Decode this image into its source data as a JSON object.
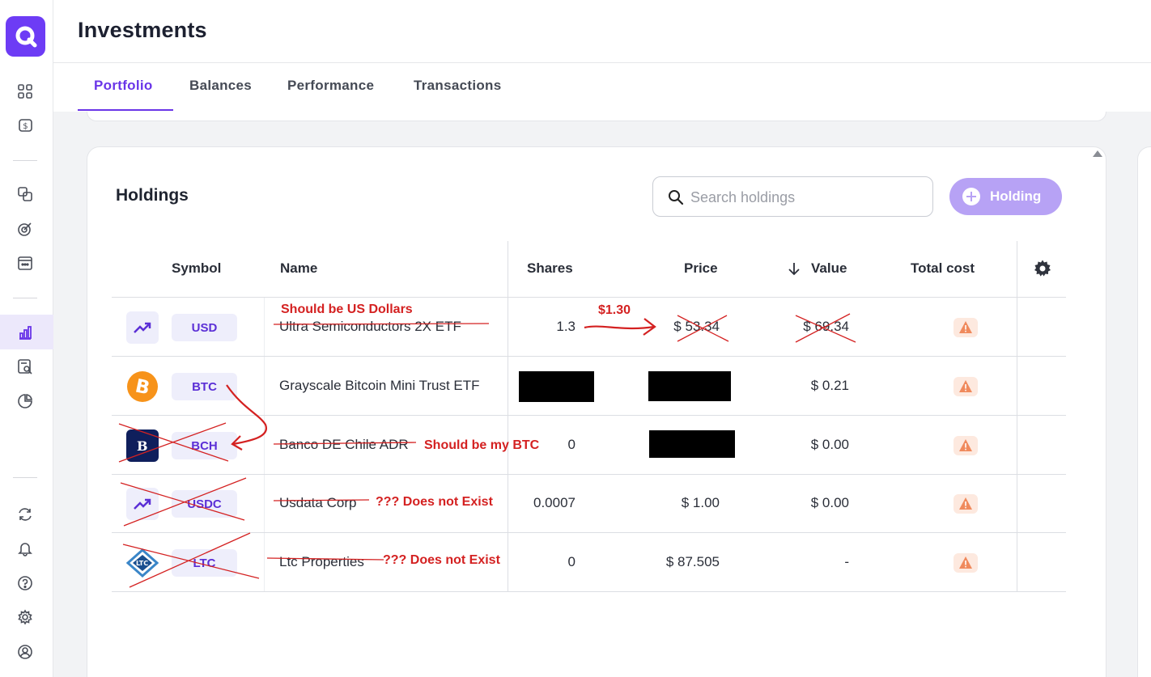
{
  "header": {
    "title": "Investments"
  },
  "tabs": [
    {
      "label": "Portfolio",
      "active": true
    },
    {
      "label": "Balances"
    },
    {
      "label": "Performance"
    },
    {
      "label": "Transactions"
    }
  ],
  "holdings": {
    "title": "Holdings",
    "search_placeholder": "Search holdings",
    "add_button": "Holding"
  },
  "table": {
    "columns": [
      "Symbol",
      "Name",
      "Shares",
      "Price",
      "Value",
      "Total cost"
    ],
    "sort_column": "Value",
    "rows": [
      {
        "symbol": "USD",
        "name": "Ultra Semiconductors 2X ETF",
        "shares": "1.3",
        "price": "$ 53.34",
        "value": "$ 69.34",
        "icon": "trend-up-icon"
      },
      {
        "symbol": "BTC",
        "name": "Grayscale Bitcoin Mini Trust ETF",
        "shares": "",
        "price": "",
        "value": "$ 0.21",
        "icon": "bitcoin-icon"
      },
      {
        "symbol": "BCH",
        "name": "Banco DE Chile ADR",
        "shares": "0",
        "price": "",
        "value": "$ 0.00",
        "icon": "banco-chile-logo-icon"
      },
      {
        "symbol": "USDC",
        "name": "Usdata Corp",
        "shares": "0.0007",
        "price": "$ 1.00",
        "value": "$ 0.00",
        "icon": "trend-up-icon"
      },
      {
        "symbol": "LTC",
        "name": "Ltc Properties",
        "shares": "0",
        "price": "$ 87.505",
        "value": "-",
        "icon": "ltc-logo-icon"
      }
    ]
  },
  "annotations": {
    "usd_name": "Should be US Dollars",
    "usd_price": "$1.30",
    "bch_note": "Should be my BTC",
    "usdc_note": "??? Does not Exist",
    "ltc_note": "??? Does not Exist"
  },
  "colors": {
    "accent": "#6a35e8",
    "annotation": "#d42121",
    "warning": "#f08a5d"
  }
}
